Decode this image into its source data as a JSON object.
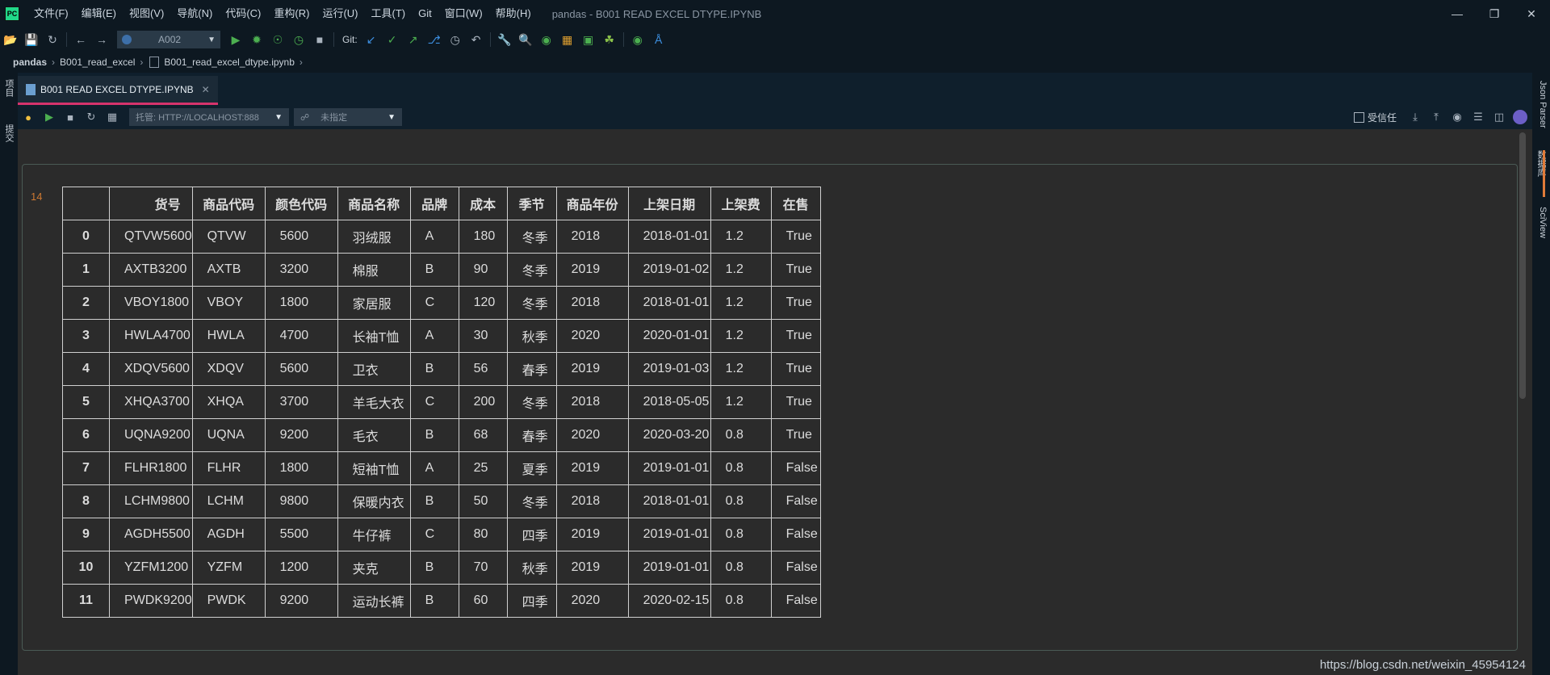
{
  "titlebar": {
    "app_logo": "PC",
    "menu": [
      "文件(F)",
      "编辑(E)",
      "视图(V)",
      "导航(N)",
      "代码(C)",
      "重构(R)",
      "运行(U)",
      "工具(T)",
      "Git",
      "窗口(W)",
      "帮助(H)"
    ],
    "window_title": "pandas - B001 READ EXCEL DTYPE.IPYNB"
  },
  "toolbar": {
    "run_config": "A002",
    "git_label": "Git:"
  },
  "breadcrumb": {
    "project": "pandas",
    "folder": "B001_read_excel",
    "file": "B001_read_excel_dtype.ipynb"
  },
  "left_strip": {
    "project_label": "项目",
    "commit_label": "提交"
  },
  "right_strip": {
    "json_parser": "Json Parser",
    "database": "数据库",
    "sciview": "SciView"
  },
  "tab": {
    "label": "B001 READ EXCEL DTYPE.IPYNB"
  },
  "notebook_toolbar": {
    "server": "托管: HTTP://LOCALHOST:888",
    "kernel": "未指定",
    "trusted_label": "受信任"
  },
  "cell": {
    "execution_count": "14"
  },
  "dataframe": {
    "columns": [
      "货号",
      "商品代码",
      "颜色代码",
      "商品名称",
      "品牌",
      "成本",
      "季节",
      "商品年份",
      "上架日期",
      "上架费",
      "在售"
    ],
    "rows": [
      {
        "index": "0",
        "values": [
          "QTVW5600",
          "QTVW",
          "5600",
          "羽绒服",
          "A",
          "180",
          "冬季",
          "2018",
          "2018-01-01",
          "1.2",
          "True"
        ]
      },
      {
        "index": "1",
        "values": [
          "AXTB3200",
          "AXTB",
          "3200",
          "棉服",
          "B",
          "90",
          "冬季",
          "2019",
          "2019-01-02",
          "1.2",
          "True"
        ]
      },
      {
        "index": "2",
        "values": [
          "VBOY1800",
          "VBOY",
          "1800",
          "家居服",
          "C",
          "120",
          "冬季",
          "2018",
          "2018-01-01",
          "1.2",
          "True"
        ]
      },
      {
        "index": "3",
        "values": [
          "HWLA4700",
          "HWLA",
          "4700",
          "长袖T恤",
          "A",
          "30",
          "秋季",
          "2020",
          "2020-01-01",
          "1.2",
          "True"
        ]
      },
      {
        "index": "4",
        "values": [
          "XDQV5600",
          "XDQV",
          "5600",
          "卫衣",
          "B",
          "56",
          "春季",
          "2019",
          "2019-01-03",
          "1.2",
          "True"
        ]
      },
      {
        "index": "5",
        "values": [
          "XHQA3700",
          "XHQA",
          "3700",
          "羊毛大衣",
          "C",
          "200",
          "冬季",
          "2018",
          "2018-05-05",
          "1.2",
          "True"
        ]
      },
      {
        "index": "6",
        "values": [
          "UQNA9200",
          "UQNA",
          "9200",
          "毛衣",
          "B",
          "68",
          "春季",
          "2020",
          "2020-03-20",
          "0.8",
          "True"
        ]
      },
      {
        "index": "7",
        "values": [
          "FLHR1800",
          "FLHR",
          "1800",
          "短袖T恤",
          "A",
          "25",
          "夏季",
          "2019",
          "2019-01-01",
          "0.8",
          "False"
        ]
      },
      {
        "index": "8",
        "values": [
          "LCHM9800",
          "LCHM",
          "9800",
          "保暖内衣",
          "B",
          "50",
          "冬季",
          "2018",
          "2018-01-01",
          "0.8",
          "False"
        ]
      },
      {
        "index": "9",
        "values": [
          "AGDH5500",
          "AGDH",
          "5500",
          "牛仔裤",
          "C",
          "80",
          "四季",
          "2019",
          "2019-01-01",
          "0.8",
          "False"
        ]
      },
      {
        "index": "10",
        "values": [
          "YZFM1200",
          "YZFM",
          "1200",
          "夹克",
          "B",
          "70",
          "秋季",
          "2019",
          "2019-01-01",
          "0.8",
          "False"
        ]
      },
      {
        "index": "11",
        "values": [
          "PWDK9200",
          "PWDK",
          "9200",
          "运动长裤",
          "B",
          "60",
          "四季",
          "2020",
          "2020-02-15",
          "0.8",
          "False"
        ]
      }
    ]
  },
  "watermark": "https://blog.csdn.net/weixin_45954124"
}
